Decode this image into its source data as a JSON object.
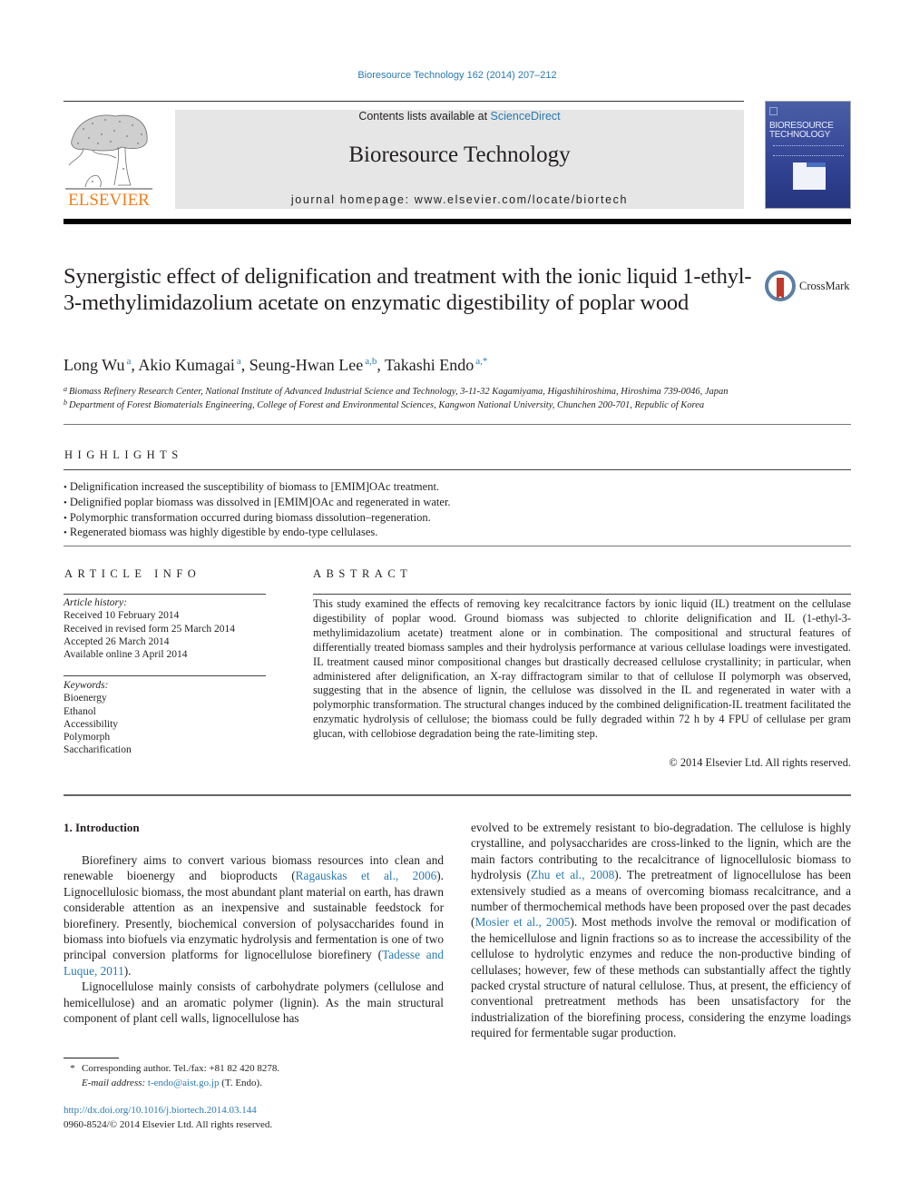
{
  "header": {
    "journal_ref": "Bioresource Technology 162 (2014) 207–212",
    "contents_prefix": "Contents lists available at ",
    "contents_link": "ScienceDirect",
    "journal_title": "Bioresource Technology",
    "homepage_prefix": "journal homepage: ",
    "homepage_url": "www.elsevier.com/locate/biortech",
    "publisher_logo_text": "ELSEVIER",
    "cover_title_line1": "BIORESOURCE",
    "cover_title_line2": "TECHNOLOGY",
    "crossmark_label": "CrossMark",
    "colors": {
      "link": "#2a7ab0",
      "elsevier_orange": "#f07f1a",
      "banner_bg": "#e6e6e6"
    }
  },
  "article": {
    "title": "Synergistic effect of delignification and treatment with the ionic liquid 1-ethyl-3-methylimidazolium acetate on enzymatic digestibility of poplar wood",
    "authors": [
      {
        "name": "Long Wu",
        "sup": "a",
        "sep": ", "
      },
      {
        "name": "Akio Kumagai",
        "sup": "a",
        "sep": ", "
      },
      {
        "name": "Seung-Hwan Lee",
        "sup": "a,b",
        "sep": ", "
      },
      {
        "name": "Takashi Endo",
        "sup": "a,*",
        "sep": ""
      }
    ],
    "affiliations": [
      {
        "mark": "a",
        "text": "Biomass Refinery Research Center, National Institute of Advanced Industrial Science and Technology, 3-11-32 Kagamiyama, Higashihiroshima, Hiroshima 739-0046, Japan"
      },
      {
        "mark": "b",
        "text": "Department of Forest Biomaterials Engineering, College of Forest and Environmental Sciences, Kangwon National University, Chunchen 200-701, Republic of Korea"
      }
    ]
  },
  "highlights": {
    "heading": "HIGHLIGHTS",
    "items": [
      "Delignification increased the susceptibility of biomass to [EMIM]OAc treatment.",
      "Delignified poplar biomass was dissolved in [EMIM]OAc and regenerated in water.",
      "Polymorphic transformation occurred during biomass dissolution–regeneration.",
      "Regenerated biomass was highly digestible by endo-type cellulases."
    ]
  },
  "article_info": {
    "heading": "ARTICLE INFO",
    "history_label": "Article history:",
    "history": [
      "Received 10 February 2014",
      "Received in revised form 25 March 2014",
      "Accepted 26 March 2014",
      "Available online 3 April 2014"
    ],
    "keywords_label": "Keywords:",
    "keywords": [
      "Bioenergy",
      "Ethanol",
      "Accessibility",
      "Polymorph",
      "Saccharification"
    ]
  },
  "abstract": {
    "heading": "ABSTRACT",
    "text": "This study examined the effects of removing key recalcitrance factors by ionic liquid (IL) treatment on the cellulase digestibility of poplar wood. Ground biomass was subjected to chlorite delignification and IL (1-ethyl-3-methylimidazolium acetate) treatment alone or in combination. The compositional and structural features of differentially treated biomass samples and their hydrolysis performance at various cellulase loadings were investigated. IL treatment caused minor compositional changes but drastically decreased cellulose crystallinity; in particular, when administered after delignification, an X-ray diffractogram similar to that of cellulose II polymorph was observed, suggesting that in the absence of lignin, the cellulose was dissolved in the IL and regenerated in water with a polymorphic transformation. The structural changes induced by the combined delignification-IL treatment facilitated the enzymatic hydrolysis of cellulose; the biomass could be fully degraded within 72 h by 4 FPU of cellulase per gram glucan, with cellobiose degradation being the rate-limiting step.",
    "copyright": "© 2014 Elsevier Ltd. All rights reserved."
  },
  "introduction": {
    "heading": "1. Introduction",
    "p1": [
      {
        "t": "Biorefinery aims to convert various biomass resources into clean and renewable bioenergy and bioproducts ("
      },
      {
        "t": "Ragauskas et al., 2006",
        "link": true
      },
      {
        "t": "). Lignocellulosic biomass, the most abundant plant material on earth, has drawn considerable attention as an inexpensive and sustainable feedstock for biorefinery. Presently, biochemical conversion of polysaccharides found in biomass into biofuels via enzymatic hydrolysis and fermentation is one of two principal conversion platforms for lignocellulose biorefinery ("
      },
      {
        "t": "Tadesse and Luque, 2011",
        "link": true
      },
      {
        "t": ")."
      }
    ],
    "p2": [
      {
        "t": "Lignocellulose mainly consists of carbohydrate polymers (cellulose and hemicellulose) and an aromatic polymer (lignin). As the main structural component of plant cell walls, lignocellulose has "
      }
    ],
    "p2_continued": [
      {
        "t": "evolved to be extremely resistant to bio-degradation. The cellulose is highly crystalline, and polysaccharides are cross-linked to the lignin, which are the main factors contributing to the recalcitrance of lignocellulosic biomass to hydrolysis ("
      },
      {
        "t": "Zhu et al., 2008",
        "link": true
      },
      {
        "t": "). The pretreatment of lignocellulose has been extensively studied as a means of overcoming biomass recalcitrance, and a number of thermochemical methods have been proposed over the past decades ("
      },
      {
        "t": "Mosier et al., 2005",
        "link": true
      },
      {
        "t": "). Most methods involve the removal or modification of the hemicellulose and lignin fractions so as to increase the accessibility of the cellulose to hydrolytic enzymes and reduce the non-productive binding of cellulases; however, few of these methods can substantially affect the tightly packed crystal structure of natural cellulose. Thus, at present, the efficiency of conventional pretreatment methods has been unsatisfactory for the industrialization of the biorefining process, considering the enzyme loadings required for fermentable sugar production."
      }
    ]
  },
  "footnotes": {
    "star": "*",
    "corresponding": "Corresponding author. Tel./fax: +81 82 420 8278.",
    "email_label": "E-mail address: ",
    "email": "t-endo@aist.go.jp",
    "email_suffix": " (T. Endo).",
    "doi": "http://dx.doi.org/10.1016/j.biortech.2014.03.144",
    "issn_copyright": "0960-8524/© 2014 Elsevier Ltd. All rights reserved."
  }
}
